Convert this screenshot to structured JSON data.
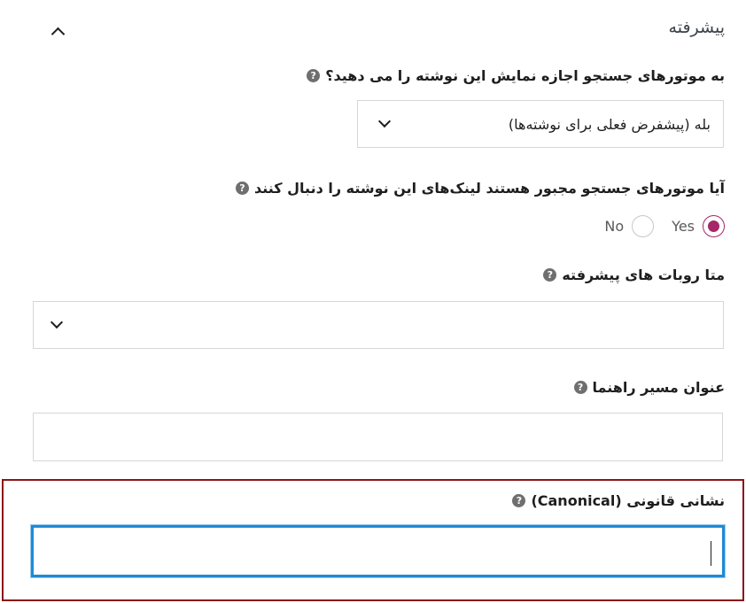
{
  "section": {
    "title": "پیشرفته"
  },
  "fields": {
    "index": {
      "label": "به موتورهای جستجو اجازه نمایش این نوشته را می دهید؟",
      "selected": "بله (پیشفرض فعلی برای نوشته‌ها)"
    },
    "follow": {
      "label": "آیا موتورهای جستجو مجبور هستند لینک‌های این نوشته را دنبال کنند",
      "options": [
        {
          "label": "Yes",
          "checked": true
        },
        {
          "label": "No",
          "checked": false
        }
      ]
    },
    "meta_robots": {
      "label": "متا روبات های پیشرفته",
      "selected": ""
    },
    "breadcrumb_title": {
      "label": "عنوان مسیر راهنما",
      "value": ""
    },
    "canonical": {
      "label": "نشانی قانونی (Canonical)",
      "value": ""
    }
  },
  "help_glyph": "?",
  "colors": {
    "radio_accent": "#a4286a",
    "focus_border": "#1e8ad6",
    "highlight_border": "#8b1414"
  }
}
